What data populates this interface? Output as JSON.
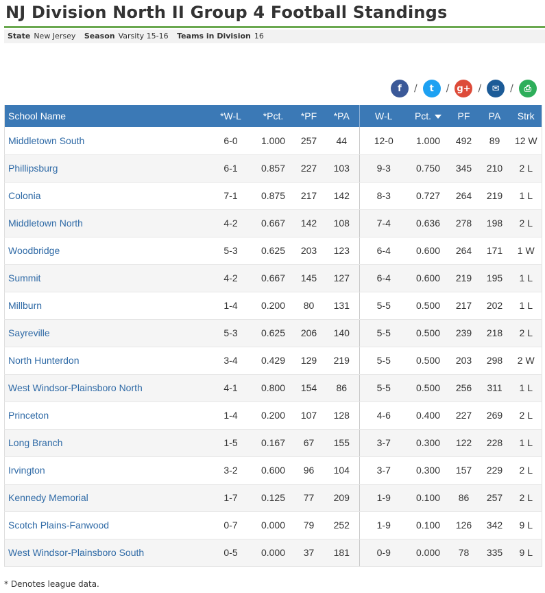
{
  "page": {
    "title": "NJ Division North II Group 4 Football Standings"
  },
  "meta": {
    "state_label": "State",
    "state_value": "New Jersey",
    "season_label": "Season",
    "season_value": "Varsity 15-16",
    "teams_label": "Teams in Division",
    "teams_value": "16"
  },
  "share": {
    "separator": "/",
    "icons": [
      {
        "name": "facebook-icon",
        "glyph": "f",
        "color": "#3b5998"
      },
      {
        "name": "twitter-icon",
        "glyph": "t",
        "color": "#1da1f2"
      },
      {
        "name": "google-plus-icon",
        "glyph": "g+",
        "color": "#dd4b39"
      },
      {
        "name": "email-icon",
        "glyph": "✉",
        "color": "#1c5b97"
      },
      {
        "name": "print-icon",
        "glyph": "⎙",
        "color": "#2eae5a"
      }
    ]
  },
  "table": {
    "headers": [
      "School Name",
      "*W-L",
      "*Pct.",
      "*PF",
      "*PA",
      "W-L",
      "Pct.",
      "PF",
      "PA",
      "Strk"
    ],
    "rows": [
      [
        "Middletown South",
        "6-0",
        "1.000",
        "257",
        "44",
        "12-0",
        "1.000",
        "492",
        "89",
        "12 W"
      ],
      [
        "Phillipsburg",
        "6-1",
        "0.857",
        "227",
        "103",
        "9-3",
        "0.750",
        "345",
        "210",
        "2 L"
      ],
      [
        "Colonia",
        "7-1",
        "0.875",
        "217",
        "142",
        "8-3",
        "0.727",
        "264",
        "219",
        "1 L"
      ],
      [
        "Middletown North",
        "4-2",
        "0.667",
        "142",
        "108",
        "7-4",
        "0.636",
        "278",
        "198",
        "2 L"
      ],
      [
        "Woodbridge",
        "5-3",
        "0.625",
        "203",
        "123",
        "6-4",
        "0.600",
        "264",
        "171",
        "1 W"
      ],
      [
        "Summit",
        "4-2",
        "0.667",
        "145",
        "127",
        "6-4",
        "0.600",
        "219",
        "195",
        "1 L"
      ],
      [
        "Millburn",
        "1-4",
        "0.200",
        "80",
        "131",
        "5-5",
        "0.500",
        "217",
        "202",
        "1 L"
      ],
      [
        "Sayreville",
        "5-3",
        "0.625",
        "206",
        "140",
        "5-5",
        "0.500",
        "239",
        "218",
        "2 L"
      ],
      [
        "North Hunterdon",
        "3-4",
        "0.429",
        "129",
        "219",
        "5-5",
        "0.500",
        "203",
        "298",
        "2 W"
      ],
      [
        "West Windsor-Plainsboro North",
        "4-1",
        "0.800",
        "154",
        "86",
        "5-5",
        "0.500",
        "256",
        "311",
        "1 L"
      ],
      [
        "Princeton",
        "1-4",
        "0.200",
        "107",
        "128",
        "4-6",
        "0.400",
        "227",
        "269",
        "2 L"
      ],
      [
        "Long Branch",
        "1-5",
        "0.167",
        "67",
        "155",
        "3-7",
        "0.300",
        "122",
        "228",
        "1 L"
      ],
      [
        "Irvington",
        "3-2",
        "0.600",
        "96",
        "104",
        "3-7",
        "0.300",
        "157",
        "229",
        "2 L"
      ],
      [
        "Kennedy Memorial",
        "1-7",
        "0.125",
        "77",
        "209",
        "1-9",
        "0.100",
        "86",
        "257",
        "2 L"
      ],
      [
        "Scotch Plains-Fanwood",
        "0-7",
        "0.000",
        "79",
        "252",
        "1-9",
        "0.100",
        "126",
        "342",
        "9 L"
      ],
      [
        "West Windsor-Plainsboro South",
        "0-5",
        "0.000",
        "37",
        "181",
        "0-9",
        "0.000",
        "78",
        "335",
        "9 L"
      ]
    ]
  },
  "footnote": "* Denotes league data."
}
